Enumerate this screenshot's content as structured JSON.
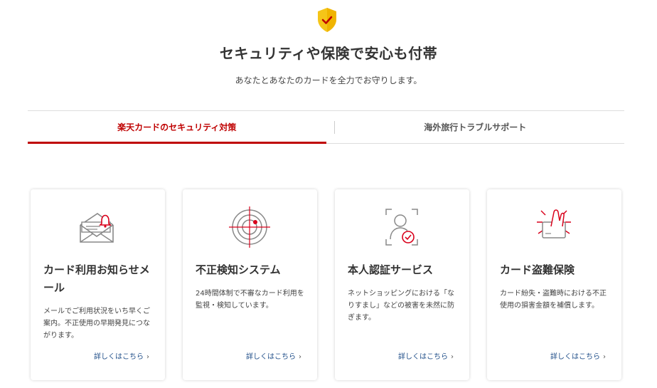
{
  "header": {
    "icon": "shield-check-icon",
    "title": "セキュリティや保険で安心も付帯",
    "subtitle": "あなたとあなたのカードを全力でお守りします。"
  },
  "tabs": [
    {
      "label": "楽天カードのセキュリティ対策",
      "active": true
    },
    {
      "label": "海外旅行トラブルサポート",
      "active": false
    }
  ],
  "cards": [
    {
      "icon": "mail-bell-icon",
      "title": "カード利用お知らせメール",
      "description": "メールでご利用状況をいち早くご案内。不正使用の早期発見につながります。",
      "link": "詳しくはこちら"
    },
    {
      "icon": "target-scan-icon",
      "title": "不正検知システム",
      "description": "24時間体制で不審なカード利用を監視・検知しています。",
      "link": "詳しくはこちら"
    },
    {
      "icon": "identity-check-icon",
      "title": "本人認証サービス",
      "description": "ネットショッピングにおける「なりすまし」などの被害を未然に防ぎます。",
      "link": "詳しくはこちら"
    },
    {
      "icon": "card-theft-icon",
      "title": "カード盗難保険",
      "description": "カード紛失・盗難時における不正使用の損害金額を補償します。",
      "link": "詳しくはこちら"
    }
  ],
  "colors": {
    "accent": "#bf0000",
    "link": "#1e4d88",
    "shield": "#f5c518"
  }
}
